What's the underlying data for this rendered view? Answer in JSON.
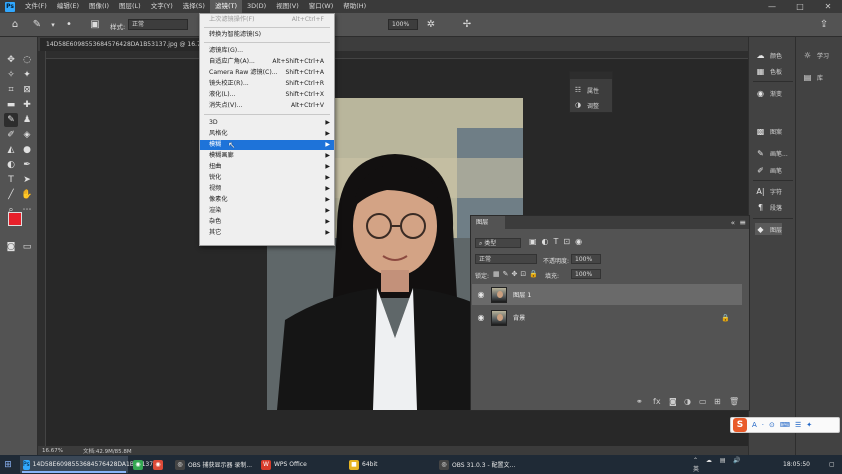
{
  "menubar": {
    "logo": "Ps",
    "items": [
      "文件(F)",
      "编辑(E)",
      "图像(I)",
      "图层(L)",
      "文字(Y)",
      "选择(S)",
      "滤镜(T)",
      "3D(D)",
      "视图(V)",
      "窗口(W)",
      "帮助(H)"
    ],
    "active_index": 6,
    "window_controls": [
      "—",
      "□",
      "✕"
    ]
  },
  "options": {
    "style_label": "样式:",
    "style_value": "正常",
    "zoom_value": "100%"
  },
  "document": {
    "tab_title": "14D58E6098553684576428DA1B53137.jpg @ 16.7..."
  },
  "filter_menu": {
    "items": [
      {
        "label": "上次滤镜操作(F)",
        "shortcut": "Alt+Ctrl+F",
        "disabled": true
      },
      {
        "sep": true
      },
      {
        "label": "转换为智能滤镜(S)",
        "shortcut": ""
      },
      {
        "sep": true
      },
      {
        "label": "滤镜库(G)...",
        "shortcut": ""
      },
      {
        "label": "自适应广角(A)...",
        "shortcut": "Alt+Shift+Ctrl+A"
      },
      {
        "label": "Camera Raw 滤镜(C)...",
        "shortcut": "Shift+Ctrl+A"
      },
      {
        "label": "镜头校正(R)...",
        "shortcut": "Shift+Ctrl+R"
      },
      {
        "label": "液化(L)...",
        "shortcut": "Shift+Ctrl+X"
      },
      {
        "label": "消失点(V)...",
        "shortcut": "Alt+Ctrl+V"
      },
      {
        "sep": true
      },
      {
        "label": "3D",
        "submenu": true
      },
      {
        "label": "风格化",
        "submenu": true
      },
      {
        "label": "模糊",
        "submenu": true,
        "highlighted": true
      },
      {
        "label": "模糊画廊",
        "submenu": true
      },
      {
        "label": "扭曲",
        "submenu": true
      },
      {
        "label": "锐化",
        "submenu": true
      },
      {
        "label": "视频",
        "submenu": true
      },
      {
        "label": "像素化",
        "submenu": true
      },
      {
        "label": "渲染",
        "submenu": true
      },
      {
        "label": "杂色",
        "submenu": true
      },
      {
        "label": "其它",
        "submenu": true
      }
    ]
  },
  "mini_panel": {
    "rows": [
      {
        "icon": "adjustments-icon",
        "label": "属性"
      },
      {
        "icon": "halfcircle-icon",
        "label": "调整"
      }
    ]
  },
  "dock1": [
    {
      "icon": "☁",
      "label": "颜色"
    },
    {
      "icon": "▦",
      "label": "色板"
    },
    {
      "icon": "◉",
      "label": "渐变"
    },
    {
      "icon": "▩",
      "label": "图案"
    },
    {
      "icon": "✎",
      "label": "画笔..."
    },
    {
      "icon": "✐",
      "label": "画笔"
    },
    {
      "icon": "A|",
      "label": "字符"
    },
    {
      "icon": "¶",
      "label": "段落"
    },
    {
      "icon": "◆",
      "label": "图层"
    }
  ],
  "dock2": [
    {
      "icon": "💡",
      "label": "学习"
    },
    {
      "icon": "▤",
      "label": "库"
    }
  ],
  "layers_panel": {
    "tab": "图层",
    "filter_kind": "类型",
    "blend_mode": "正常",
    "opacity_label": "不透明度:",
    "opacity_value": "100%",
    "lock_label": "锁定:",
    "fill_label": "填充:",
    "fill_value": "100%",
    "layers": [
      {
        "name": "图层 1",
        "selected": true,
        "locked": false
      },
      {
        "name": "背景",
        "selected": false,
        "locked": true
      }
    ]
  },
  "status": {
    "zoom": "16.67%",
    "doc": "文档:42.9M/85.8M"
  },
  "taskbar": {
    "items": [
      {
        "label": "14D58E6098553684576428DA1B53137...",
        "color": "#31a8ff",
        "glyph": "Ps",
        "active": true
      },
      {
        "label": "",
        "color": "#34a853",
        "glyph": "◉"
      },
      {
        "label": "OBS 捕获显示器 录制...",
        "color": "#444",
        "glyph": "◎"
      },
      {
        "label": "WPS Office",
        "color": "#d83b2a",
        "glyph": "W"
      },
      {
        "label": "64bit",
        "color": "#e6b422",
        "glyph": "■"
      },
      {
        "label": "OBS 31.0.3 - 配置文...",
        "color": "#444",
        "glyph": "◎"
      }
    ],
    "time": "18:05:50"
  },
  "ime": {
    "brand": "S",
    "keys": [
      "A",
      "·",
      "⊙",
      "⌨",
      "☰",
      "✦"
    ]
  }
}
